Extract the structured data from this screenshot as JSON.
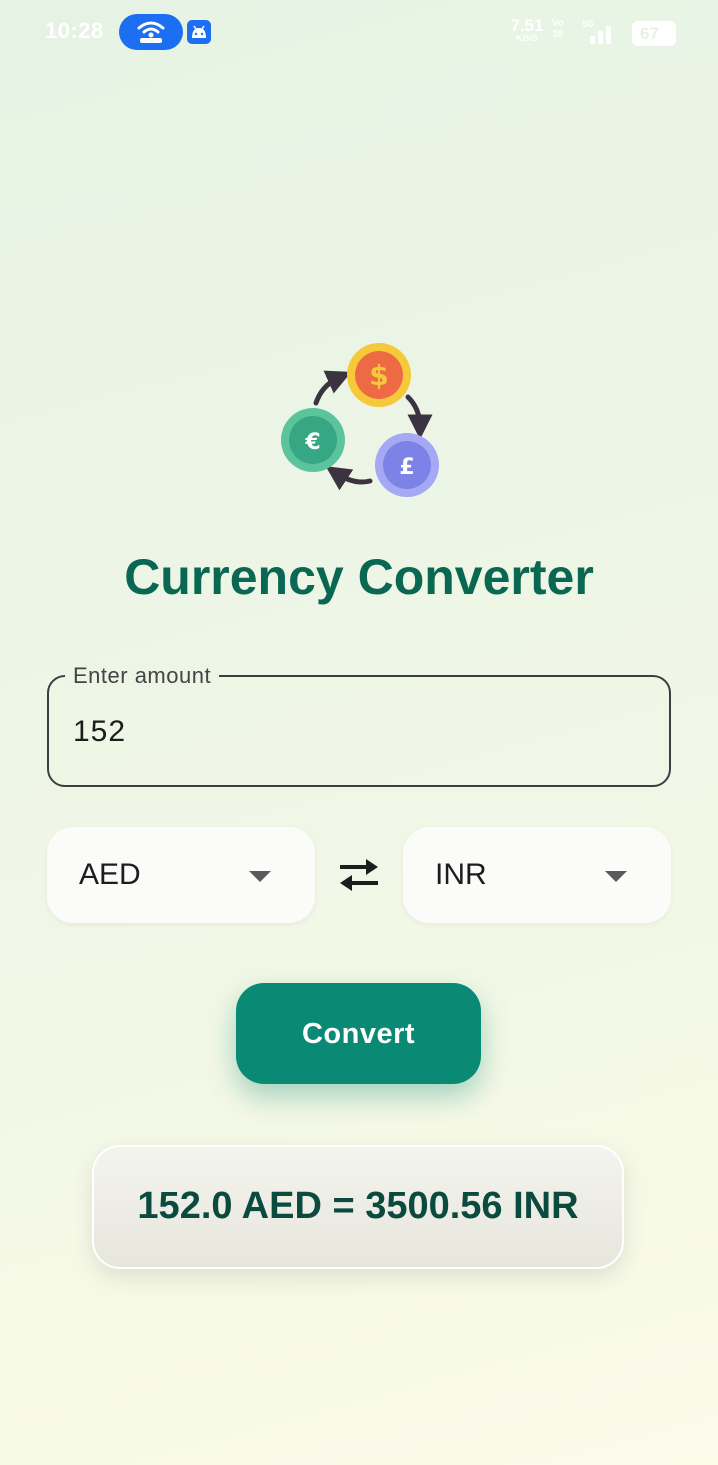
{
  "status_bar": {
    "time": "10:28",
    "net_speed_value": "7.51",
    "net_speed_unit": "KB/S",
    "volte_top": "Vo",
    "volte_bottom": "38",
    "network_type": "5G",
    "battery": "67"
  },
  "app": {
    "logo_icon": "currency-exchange-icon",
    "title": "Currency Converter"
  },
  "amount_field": {
    "label": "Enter amount",
    "value": "152"
  },
  "from_currency": {
    "selected": "AED"
  },
  "to_currency": {
    "selected": "INR"
  },
  "swap_icon": "swap-arrows-icon",
  "convert_button": {
    "label": "Convert"
  },
  "result": {
    "text": "152.0 AED = 3500.56 INR"
  },
  "colors": {
    "primary": "#0a8a74",
    "title": "#0a6752",
    "result_text": "#0b4a3e",
    "coin_yellow": "#f6c93a",
    "coin_red": "#ee6a45",
    "coin_green": "#37a783",
    "coin_purple": "#7d83e6"
  }
}
